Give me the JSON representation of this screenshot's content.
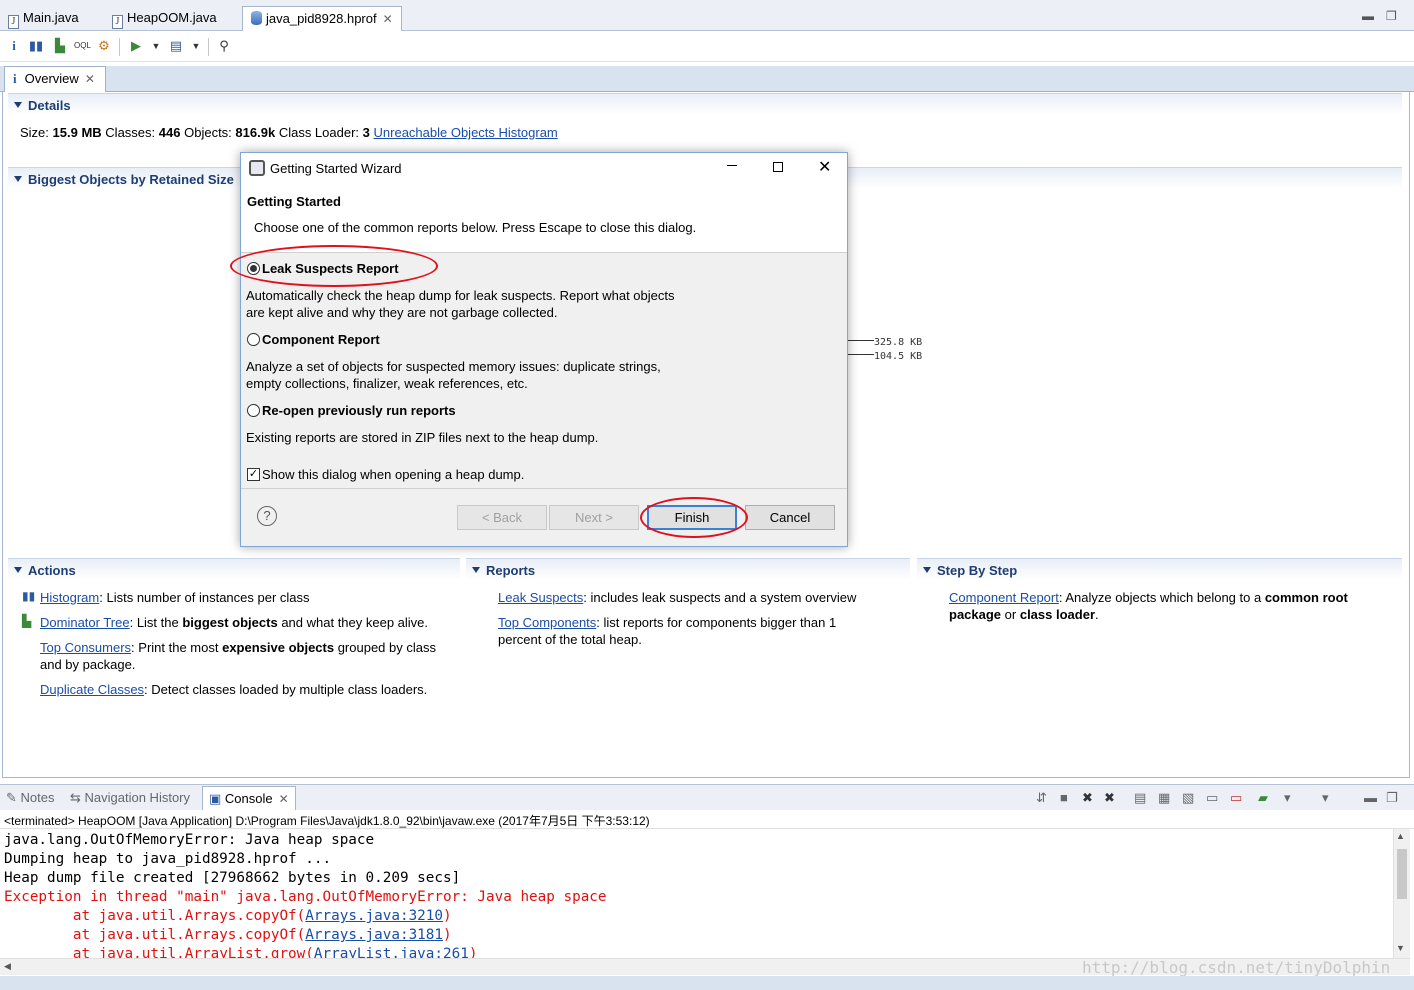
{
  "editor_tabs": [
    {
      "label": "Main.java"
    },
    {
      "label": "HeapOOM.java"
    },
    {
      "label": "java_pid8928.hprof"
    }
  ],
  "overview": {
    "tab_label": "Overview",
    "details": {
      "title": "Details",
      "size_label": "Size:",
      "size_value": "15.9 MB",
      "classes_label": "Classes:",
      "classes_value": "446",
      "objects_label": "Objects:",
      "objects_value": "816.9k",
      "loader_label": "Class Loader:",
      "loader_value": "3",
      "histogram_link": "Unreachable Objects Histogram"
    },
    "biggest_title": "Biggest Objects by Retained Size",
    "biggest_values": [
      "325.8 KB",
      "104.5 KB"
    ],
    "actions": {
      "title": "Actions",
      "items": [
        {
          "link": "Histogram",
          "text": ": Lists number of instances per class"
        },
        {
          "link": "Dominator Tree",
          "text1": ": List the ",
          "bold": "biggest objects",
          "text2": " and what they keep alive."
        },
        {
          "link": "Top Consumers",
          "text1": ": Print the most ",
          "bold": "expensive objects",
          "text2": " grouped by class",
          "line2": "and by package."
        },
        {
          "link": "Duplicate Classes",
          "text": ": Detect classes loaded by multiple class loaders."
        }
      ]
    },
    "reports": {
      "title": "Reports",
      "items": [
        {
          "link": "Leak Suspects",
          "text": ": includes leak suspects and a system overview"
        },
        {
          "link": "Top Components",
          "text": ": list reports for components bigger than 1",
          "line2": "percent of the total heap."
        }
      ]
    },
    "step": {
      "title": "Step By Step",
      "link": "Component Report",
      "text1": ": Analyze objects which belong to a ",
      "bold1": "common root",
      "bold2": "package",
      "text2": " or ",
      "bold3": "class loader",
      "text3": "."
    }
  },
  "dialog": {
    "title": "Getting Started Wizard",
    "heading": "Getting Started",
    "subtitle": "Choose one of the common reports below. Press Escape to close this dialog.",
    "options": [
      {
        "label": "Leak Suspects Report",
        "selected": true,
        "desc1": "Automatically check the heap dump for leak suspects. Report what objects",
        "desc2": "are kept alive and why they are not garbage collected."
      },
      {
        "label": "Component Report",
        "selected": false,
        "desc1": "Analyze a set of objects for suspected memory issues: duplicate strings,",
        "desc2": "empty collections, finalizer, weak references, etc."
      },
      {
        "label": "Re-open previously run reports",
        "selected": false,
        "desc1": "Existing reports are stored in ZIP files next to the heap dump."
      }
    ],
    "show_dialog_label": "Show this dialog when opening a heap dump.",
    "show_dialog_checked": true,
    "buttons": {
      "back": "< Back",
      "next": "Next >",
      "finish": "Finish",
      "cancel": "Cancel"
    }
  },
  "bottom_tabs": [
    {
      "label": "Notes"
    },
    {
      "label": "Navigation History"
    },
    {
      "label": "Console"
    }
  ],
  "console": {
    "status": "<terminated> HeapOOM [Java Application] D:\\Program Files\\Java\\jdk1.8.0_92\\bin\\javaw.exe (2017年7月5日 下午3:53:12)",
    "lines": [
      {
        "text": "java.lang.OutOfMemoryError: Java heap space",
        "type": "out"
      },
      {
        "text": "Dumping heap to java_pid8928.hprof ...",
        "type": "out"
      },
      {
        "text": "Heap dump file created [27968662 bytes in 0.209 secs]",
        "type": "out"
      },
      {
        "text": "Exception in thread \"main\" java.lang.OutOfMemoryError: Java heap space",
        "type": "err"
      }
    ],
    "stack": [
      {
        "prefix": "\tat java.util.Arrays.copyOf(",
        "link": "Arrays.java:3210",
        "suffix": ")"
      },
      {
        "prefix": "\tat java.util.Arrays.copyOf(",
        "link": "Arrays.java:3181",
        "suffix": ")"
      },
      {
        "prefix": "\tat java.util.ArrayList.grow(",
        "link": "ArrayList.java:261",
        "suffix": ")"
      }
    ]
  },
  "watermark": "http://blog.csdn.net/tinyDolphin",
  "colors": {
    "accent": "#1e3e73",
    "link": "#1a4da8",
    "error": "#e01010",
    "highlight": "#e0101c"
  }
}
